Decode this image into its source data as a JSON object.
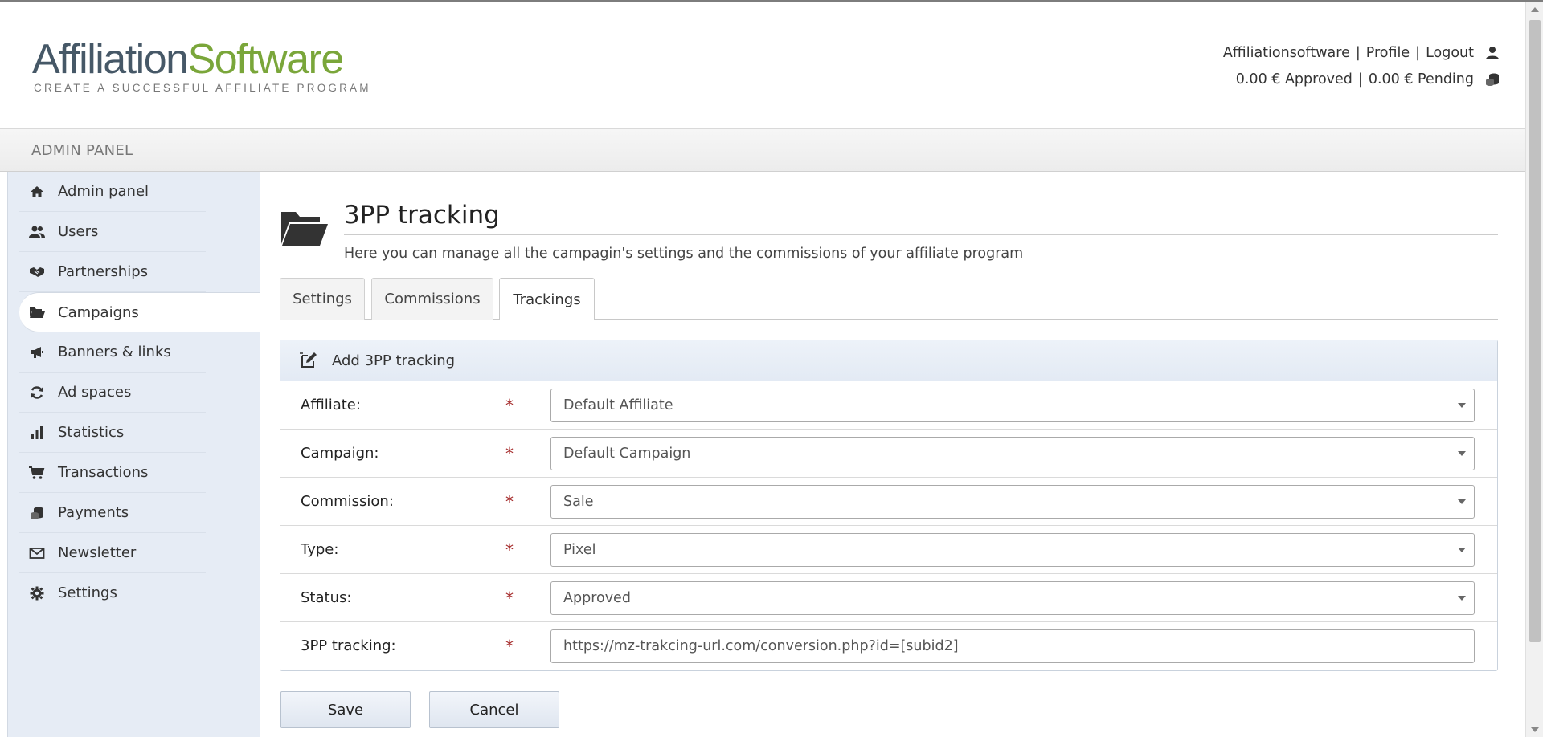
{
  "logo": {
    "part1": "Affiliation",
    "part2": "Software",
    "tagline": "CREATE A SUCCESSFUL AFFILIATE PROGRAM"
  },
  "userbar": {
    "username": "Affiliationsoftware",
    "profile": "Profile",
    "logout": "Logout",
    "separator": "|",
    "approved": "0.00 € Approved",
    "pending": "0.00 € Pending"
  },
  "admin_band": "ADMIN PANEL",
  "sidebar": {
    "items": [
      {
        "label": "Admin panel",
        "icon": "home-icon"
      },
      {
        "label": "Users",
        "icon": "users-icon"
      },
      {
        "label": "Partnerships",
        "icon": "handshake-icon"
      },
      {
        "label": "Campaigns",
        "icon": "folder-open-icon",
        "active": true
      },
      {
        "label": "Banners & links",
        "icon": "megaphone-icon"
      },
      {
        "label": "Ad spaces",
        "icon": "refresh-icon"
      },
      {
        "label": "Statistics",
        "icon": "bar-chart-icon"
      },
      {
        "label": "Transactions",
        "icon": "cart-icon"
      },
      {
        "label": "Payments",
        "icon": "coins-icon"
      },
      {
        "label": "Newsletter",
        "icon": "envelope-icon"
      },
      {
        "label": "Settings",
        "icon": "gear-icon"
      }
    ]
  },
  "page": {
    "title": "3PP tracking",
    "description": "Here you can manage all the campagin's settings and the commissions of your affiliate program"
  },
  "tabs": [
    {
      "label": "Settings"
    },
    {
      "label": "Commissions"
    },
    {
      "label": "Trackings",
      "active": true
    }
  ],
  "panel": {
    "title": "Add 3PP tracking",
    "required_mark": "*",
    "fields": [
      {
        "label": "Affiliate:",
        "value": "Default Affiliate",
        "kind": "select"
      },
      {
        "label": "Campaign:",
        "value": "Default Campaign",
        "kind": "select"
      },
      {
        "label": "Commission:",
        "value": "Sale",
        "kind": "select"
      },
      {
        "label": "Type:",
        "value": "Pixel",
        "kind": "select"
      },
      {
        "label": "Status:",
        "value": "Approved",
        "kind": "select"
      },
      {
        "label": "3PP tracking:",
        "value": "https://mz-trakcing-url.com/conversion.php?id=[subid2]",
        "kind": "input"
      }
    ]
  },
  "buttons": {
    "save": "Save",
    "cancel": "Cancel"
  },
  "colors": {
    "logo_dark": "#465867",
    "logo_green": "#7aa63a",
    "sidebar_bg": "#e6ecf5",
    "required": "#a52a2a"
  }
}
